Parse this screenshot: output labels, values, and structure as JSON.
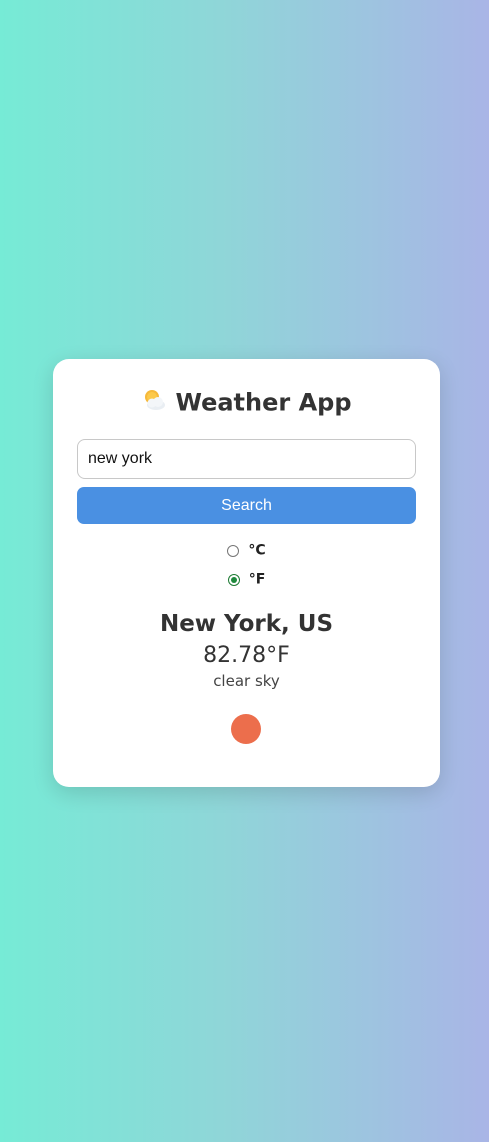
{
  "app": {
    "title": "Weather App",
    "icon": "sun-behind-cloud-icon"
  },
  "search": {
    "value": "new york",
    "placeholder": "",
    "button_label": "Search"
  },
  "units": {
    "options": [
      {
        "label": "°C",
        "checked": false
      },
      {
        "label": "°F",
        "checked": true
      }
    ]
  },
  "result": {
    "city": "New York, US",
    "temperature": "82.78°F",
    "description": "clear sky",
    "icon": "clear-sky-sun-icon",
    "icon_color": "#ec6e4c"
  },
  "colors": {
    "accent": "#4a90e2",
    "gradient_start": "#76ebd6",
    "gradient_end": "#a9b5e6"
  }
}
